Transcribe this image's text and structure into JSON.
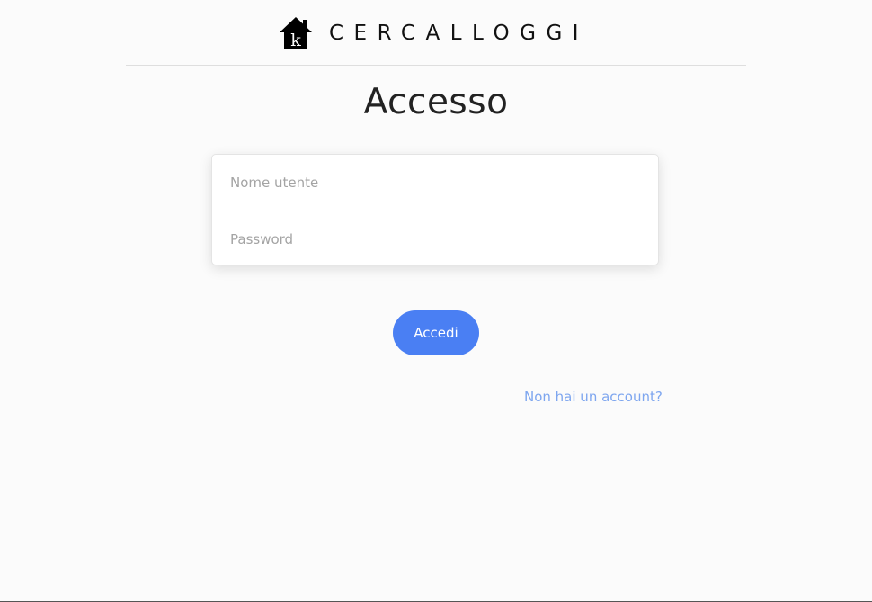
{
  "header": {
    "brand_name": "CERCALLOGGI",
    "logo_icon": "house-k-logo-icon",
    "logo_letter": "k"
  },
  "main": {
    "title": "Accesso",
    "form": {
      "username": {
        "placeholder": "Nome utente",
        "value": ""
      },
      "password": {
        "placeholder": "Password",
        "value": ""
      },
      "submit_label": "Accedi"
    },
    "register_link": "Non hai un account?"
  },
  "colors": {
    "accent": "#4a7ff3",
    "link": "#7ea6ef",
    "background": "#fbfbfb",
    "text": "#222222"
  }
}
